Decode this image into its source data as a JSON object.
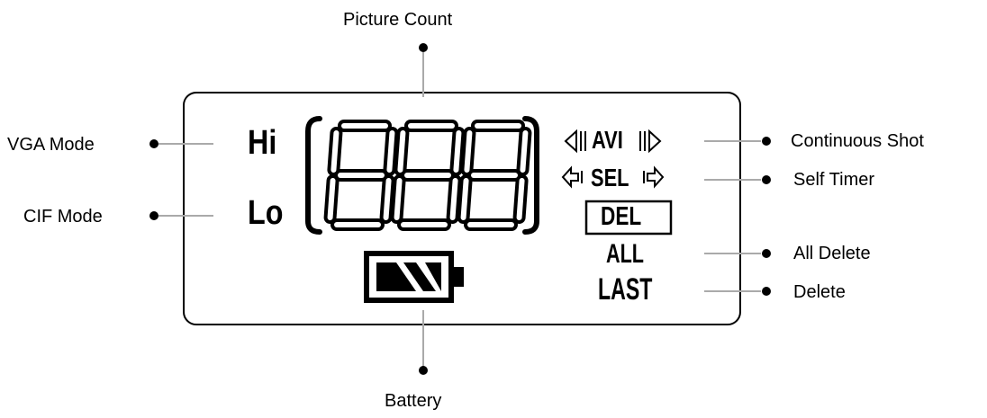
{
  "callouts": {
    "picture_count": "Picture Count",
    "battery": "Battery",
    "vga_mode": "VGA Mode",
    "cif_mode": "CIF Mode",
    "continuous_shot": "Continuous Shot",
    "self_timer": "Self Timer",
    "all_delete": "All Delete",
    "delete": "Delete"
  },
  "lcd": {
    "hi": "Hi",
    "lo": "Lo",
    "digits": "888",
    "avi": "AVI",
    "sel": "SEL",
    "del": "DEL",
    "all": "ALL",
    "last": "LAST"
  }
}
